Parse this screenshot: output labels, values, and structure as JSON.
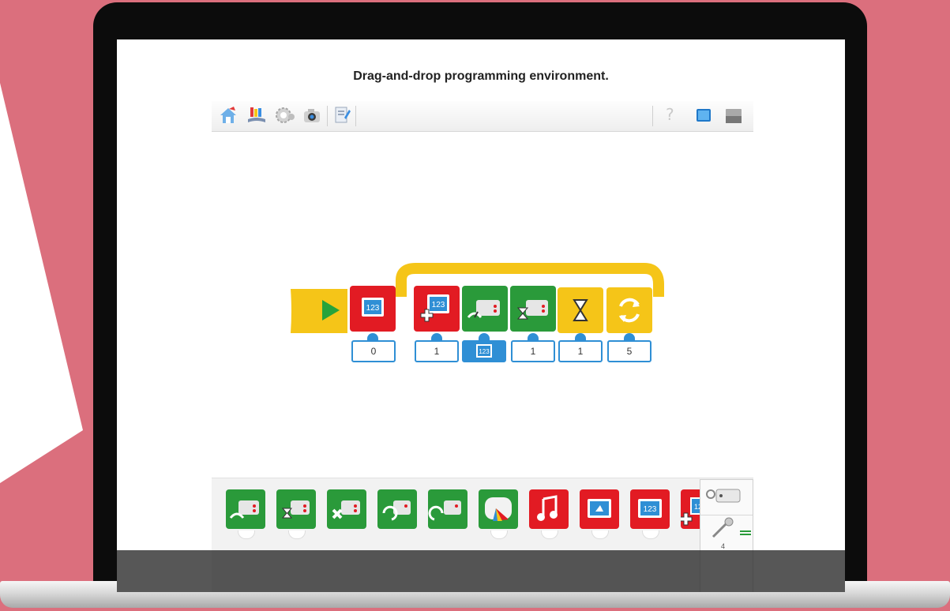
{
  "caption": "Drag-and-drop programming environment.",
  "toolbar": {
    "items": [
      "home-icon",
      "getting-started-icon",
      "gear-settings-icon",
      "camera-icon",
      "document-icon"
    ],
    "help_label": "?"
  },
  "program": {
    "blocks": [
      {
        "name": "start-block",
        "color": "#f5c518"
      },
      {
        "name": "number-block",
        "color": "#e21b23",
        "param": "0"
      },
      {
        "name": "add-number-block",
        "color": "#e21b23",
        "param": "1"
      },
      {
        "name": "motor-power-block",
        "color": "#2a9a3a",
        "param_icon": "number-input-icon"
      },
      {
        "name": "motor-on-for-block",
        "color": "#2a9a3a",
        "param": "1"
      },
      {
        "name": "wait-block",
        "color": "#f5c518",
        "param": "1"
      },
      {
        "name": "repeat-block",
        "color": "#f5c518",
        "param": "5"
      }
    ],
    "params": {
      "p0": "0",
      "p1": "1",
      "p3": "1",
      "p4": "1",
      "p5": "5"
    }
  },
  "palette": {
    "items": [
      "motor-power-icon",
      "motor-on-for-icon",
      "motor-off-icon",
      "motor-counterclockwise-icon",
      "motor-clockwise-icon",
      "light-color-icon",
      "sound-icon",
      "display-icon",
      "number-icon",
      "add-number-icon"
    ],
    "side_count": "4"
  },
  "colors": {
    "background": "#db6f7d",
    "green": "#2a9a3a",
    "red": "#e21b23",
    "yellow": "#f5c518",
    "blue": "#2f8fd5"
  }
}
